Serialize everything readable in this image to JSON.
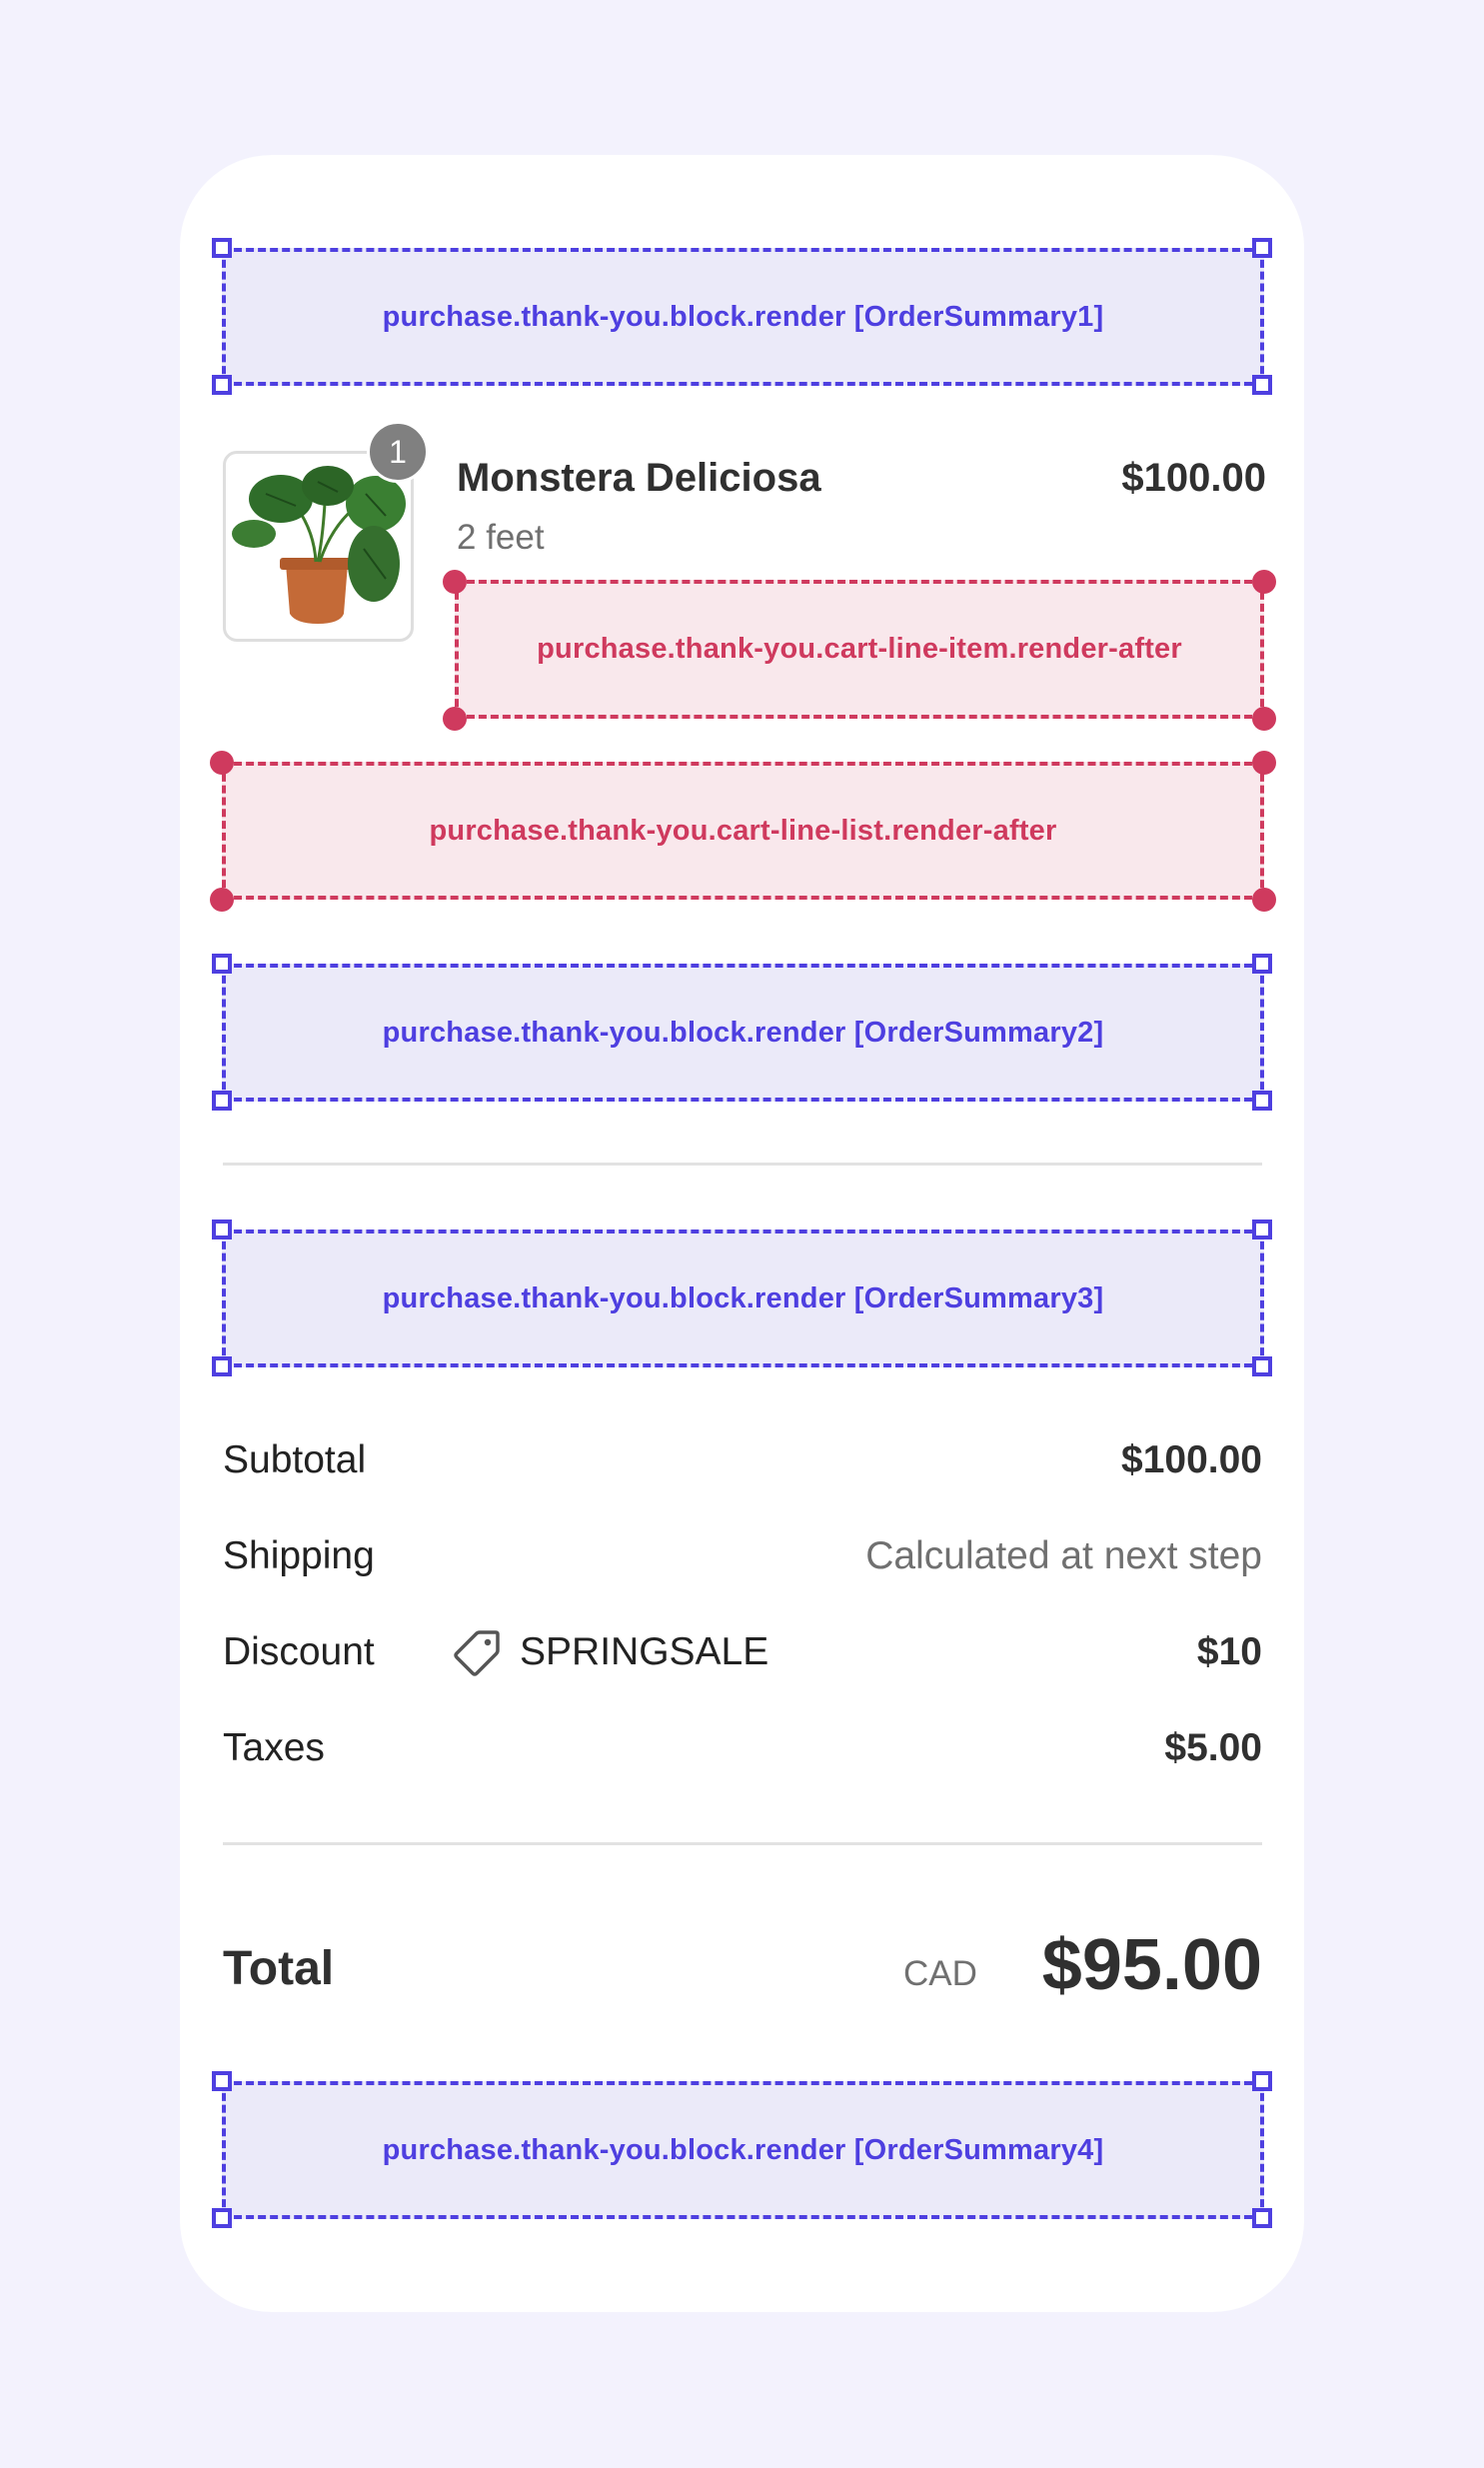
{
  "extensions": {
    "order_summary_1": "purchase.thank-you.block.render [OrderSummary1]",
    "line_item_after": "purchase.thank-you.cart-line-item.render-after",
    "line_list_after": "purchase.thank-you.cart-line-list.render-after",
    "order_summary_2": "purchase.thank-you.block.render [OrderSummary2]",
    "order_summary_3": "purchase.thank-you.block.render [OrderSummary3]",
    "order_summary_4": "purchase.thank-you.block.render [OrderSummary4]"
  },
  "line_item": {
    "quantity": "1",
    "title": "Monstera Deliciosa",
    "variant": "2 feet",
    "price": "$100.00",
    "image": "monstera-plant-image"
  },
  "summary": {
    "subtotal_label": "Subtotal",
    "subtotal_value": "$100.00",
    "shipping_label": "Shipping",
    "shipping_value": "Calculated at next step",
    "discount_label": "Discount",
    "discount_code": "SPRINGSALE",
    "discount_value": "$10",
    "taxes_label": "Taxes",
    "taxes_value": "$5.00"
  },
  "total": {
    "label": "Total",
    "currency": "CAD",
    "amount": "$95.00"
  },
  "colors": {
    "extension_blue": "#4e3fe0",
    "extension_red": "#cf3a5e",
    "background": "#f3f2fd"
  }
}
